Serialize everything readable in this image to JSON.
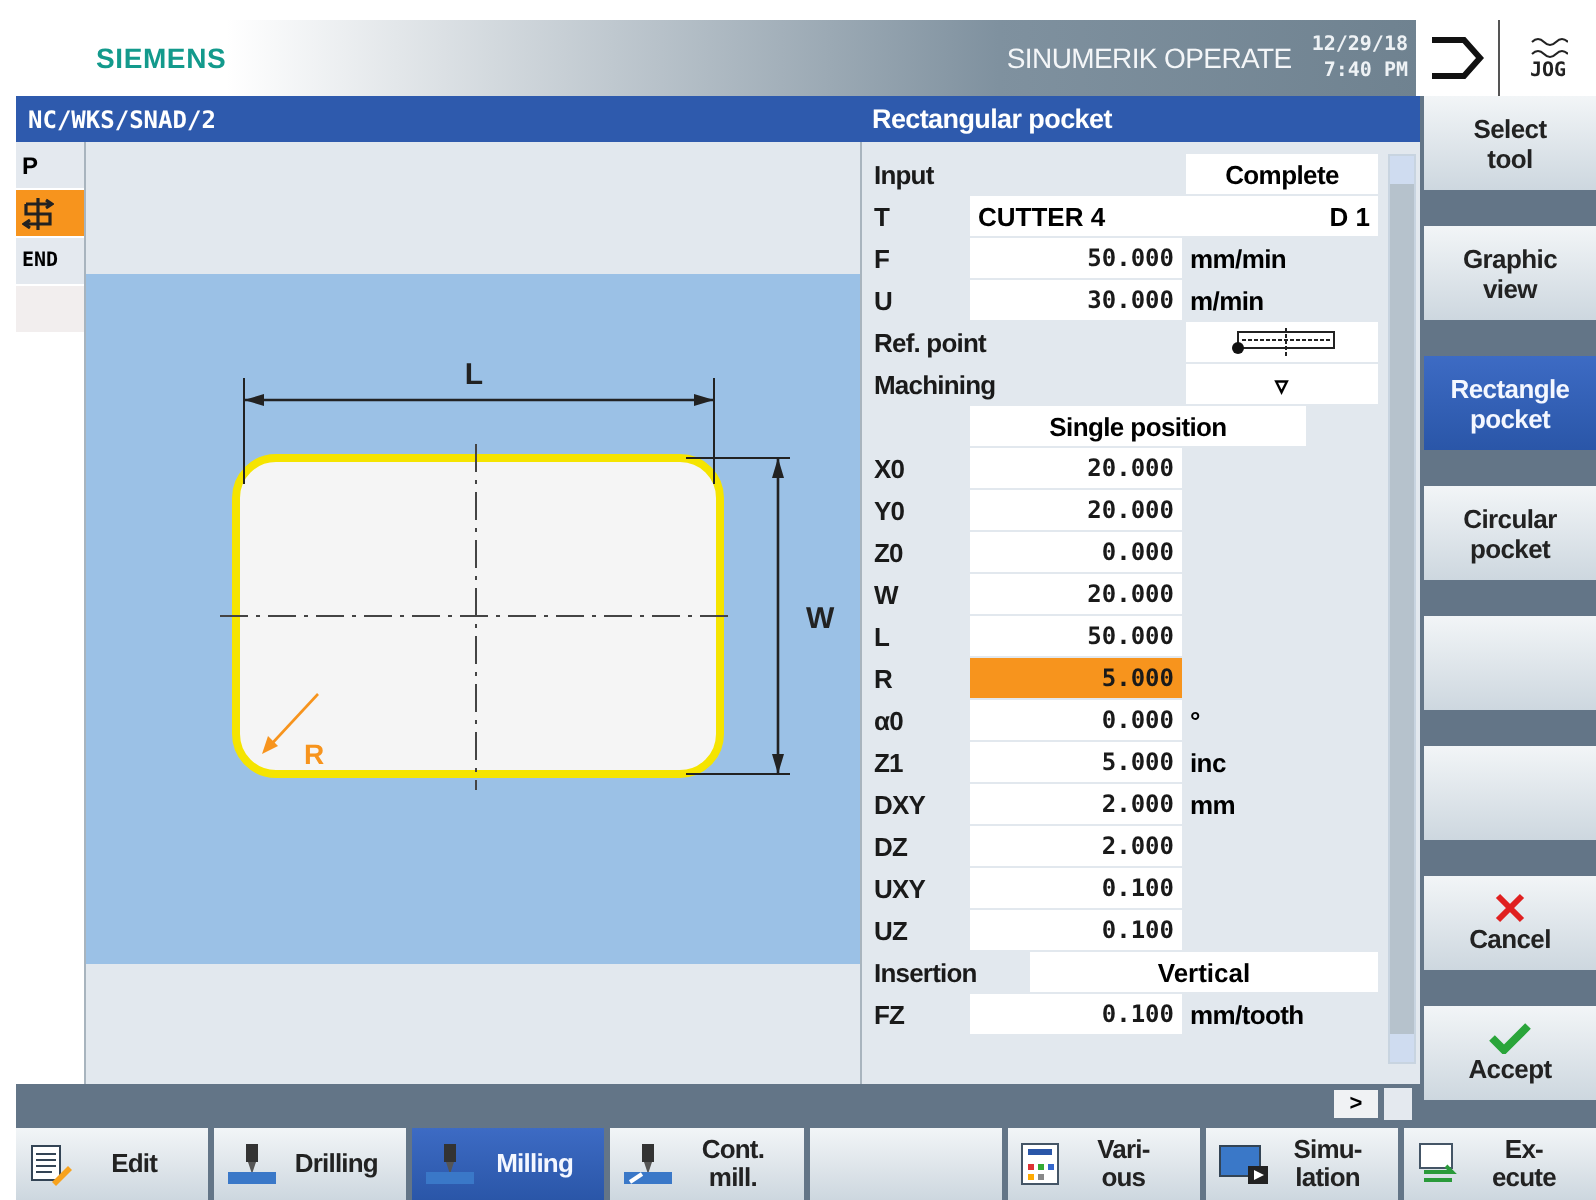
{
  "header": {
    "brand": "SIEMENS",
    "product": "SINUMERIK OPERATE",
    "date": "12/29/18",
    "time": "7:40 PM",
    "mode": "JOG"
  },
  "title_bar": {
    "path": "NC/WKS/SNAD/2",
    "form_title": "Rectangular pocket"
  },
  "program_strip": [
    {
      "kind": "text",
      "label": "P",
      "selected": false
    },
    {
      "kind": "cycle",
      "selected": true
    },
    {
      "kind": "text",
      "label": "END",
      "selected": false
    },
    {
      "kind": "empty",
      "selected": false
    }
  ],
  "graphic": {
    "length_label": "L",
    "width_label": "W",
    "radius_label": "R"
  },
  "form": {
    "rows": [
      {
        "kind": "choice",
        "label": "Input",
        "value": "Complete"
      },
      {
        "kind": "tool",
        "label": "T",
        "value": "CUTTER 4",
        "d": "D 1"
      },
      {
        "kind": "number",
        "label": "F",
        "value": "50.000",
        "unit": "mm/min",
        "selected": false
      },
      {
        "kind": "number",
        "label": "U",
        "value": "30.000",
        "unit": "m/min",
        "selected": false
      },
      {
        "kind": "refpoint",
        "label": "Ref. point"
      },
      {
        "kind": "choice",
        "label": "Machining",
        "value": "▿"
      },
      {
        "kind": "position",
        "value": "Single position"
      },
      {
        "kind": "number",
        "label": "X0",
        "value": "20.000",
        "selected": false
      },
      {
        "kind": "number",
        "label": "Y0",
        "value": "20.000",
        "selected": false
      },
      {
        "kind": "number",
        "label": "Z0",
        "value": "0.000",
        "selected": false
      },
      {
        "kind": "number",
        "label": "W",
        "value": "20.000",
        "selected": false
      },
      {
        "kind": "number",
        "label": "L",
        "value": "50.000",
        "selected": false
      },
      {
        "kind": "number",
        "label": "R",
        "value": "5.000",
        "selected": true
      },
      {
        "kind": "number",
        "label": "α0",
        "value": "0.000",
        "unit": "°",
        "selected": false
      },
      {
        "kind": "number",
        "label": "Z1",
        "value": "5.000",
        "unit": "inc",
        "selected": false
      },
      {
        "kind": "number",
        "label": "DXY",
        "value": "2.000",
        "unit": "mm",
        "selected": false
      },
      {
        "kind": "number",
        "label": "DZ",
        "value": "2.000",
        "selected": false
      },
      {
        "kind": "number",
        "label": "UXY",
        "value": "0.100",
        "selected": false
      },
      {
        "kind": "number",
        "label": "UZ",
        "value": "0.100",
        "selected": false
      },
      {
        "kind": "wide_choice",
        "label": "Insertion",
        "value": "Vertical"
      },
      {
        "kind": "number",
        "label": "FZ",
        "value": "0.100",
        "unit": "mm/tooth",
        "selected": false
      }
    ]
  },
  "scroll_button": ">",
  "vertical_softkeys": [
    {
      "label": "Select\ntool",
      "selected": false
    },
    {
      "label": "Graphic\nview",
      "selected": false
    },
    {
      "label": "Rectangle\npocket",
      "selected": true
    },
    {
      "label": "Circular\npocket",
      "selected": false
    },
    {
      "selected": false
    },
    {
      "selected": false
    },
    {
      "label": "Cancel",
      "kind": "cancel",
      "selected": false
    },
    {
      "label": "Accept",
      "kind": "accept",
      "selected": false
    }
  ],
  "horizontal_softkeys": [
    {
      "label": "Edit",
      "kind": "edit",
      "selected": false
    },
    {
      "label": "Drilling",
      "kind": "drill",
      "selected": false
    },
    {
      "label": "Milling",
      "kind": "mill",
      "selected": true
    },
    {
      "label": "Cont.\nmill.",
      "kind": "contour",
      "selected": false
    },
    {
      "kind": "blank",
      "selected": false
    },
    {
      "label": "Vari-\nous",
      "kind": "various",
      "selected": false
    },
    {
      "label": "Simu-\nlation",
      "kind": "simulation",
      "selected": false
    },
    {
      "label": "Ex-\necute",
      "kind": "execute",
      "selected": false
    }
  ]
}
